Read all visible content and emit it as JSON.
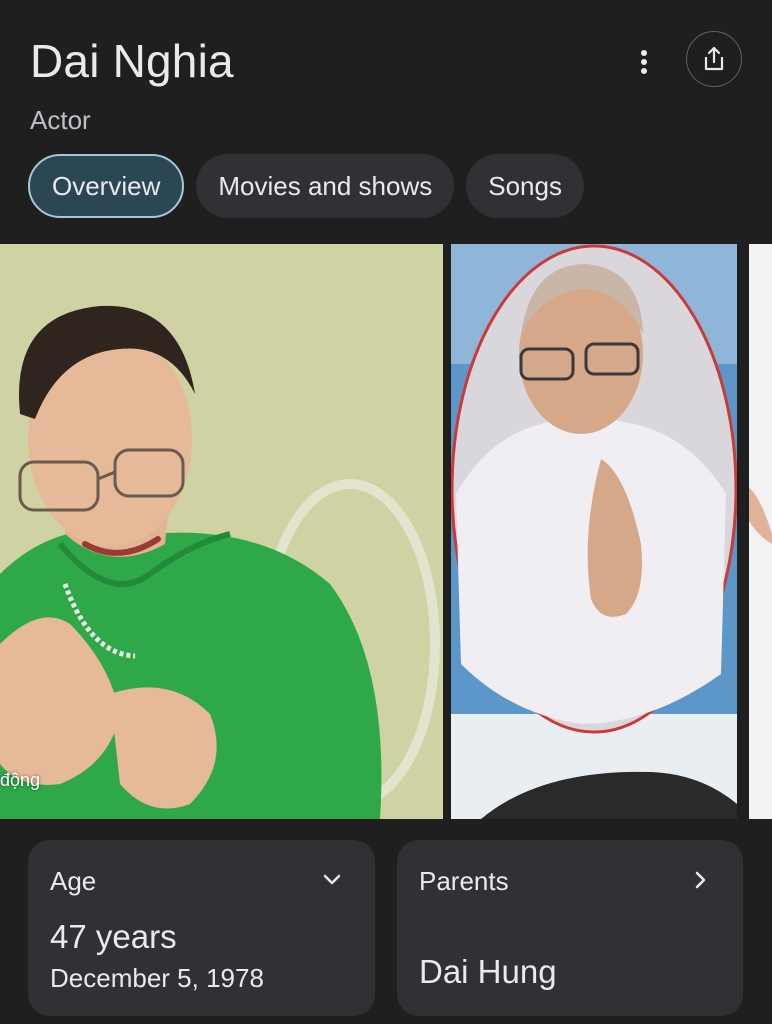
{
  "knowledge_panel": {
    "title": "Dai Nghia",
    "subtitle": "Actor",
    "icons": {
      "more": "more-vert-icon",
      "share": "share-icon"
    }
  },
  "tabs": [
    {
      "label": "Overview",
      "active": true
    },
    {
      "label": "Movies and shows",
      "active": false
    },
    {
      "label": "Songs",
      "active": false
    }
  ],
  "gallery": {
    "photo1_caption": "động"
  },
  "cards": {
    "age": {
      "label": "Age",
      "value": "47 years",
      "sub": "December 5, 1978",
      "icon": "chevron-down-icon"
    },
    "parents": {
      "label": "Parents",
      "value": "Dai Hung",
      "icon": "chevron-right-icon"
    }
  },
  "colors": {
    "background": "#1f1f1f",
    "chip": "#303134",
    "chip_active": "#2c4754",
    "chip_active_border": "#a8c7d6",
    "card": "#303134",
    "text": "#e8eaed"
  }
}
